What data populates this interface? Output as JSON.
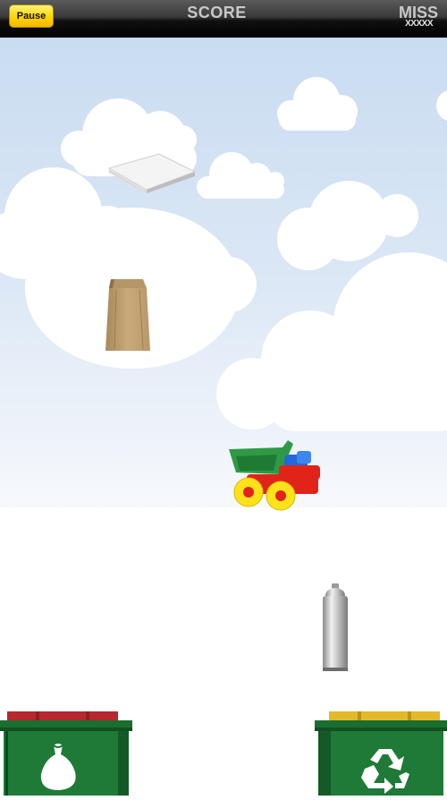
{
  "hud": {
    "pause_label": "Pause",
    "score_label": "SCORE",
    "miss_label": "MISS",
    "miss_marks": "XXXXX"
  },
  "falling_items": [
    {
      "name": "paper-stack"
    },
    {
      "name": "paper-bag"
    },
    {
      "name": "toy-truck"
    },
    {
      "name": "aerosol-can"
    }
  ],
  "bins": [
    {
      "name": "trash-bin",
      "lid_color": "#b5282e",
      "body_color": "#1e7a36",
      "icon": "trash-bag-icon"
    },
    {
      "name": "recycle-bin",
      "lid_color": "#e2b92a",
      "body_color": "#1e7a36",
      "icon": "recycle-icon"
    }
  ]
}
